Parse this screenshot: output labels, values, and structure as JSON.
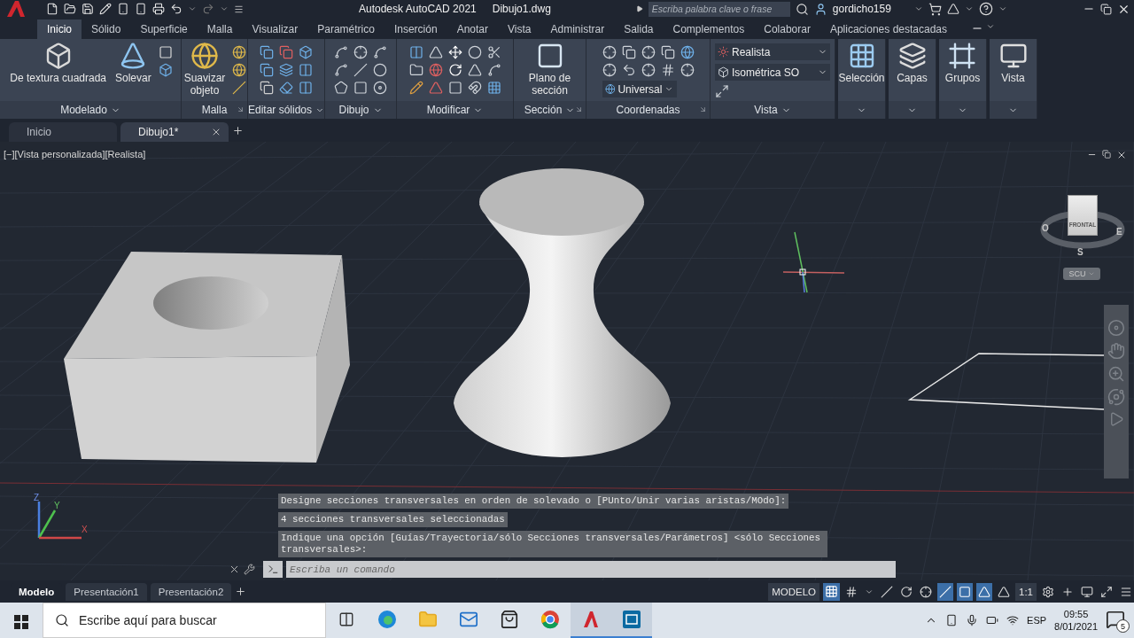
{
  "title_bar": {
    "app": "Autodesk AutoCAD 2021",
    "file": "Dibujo1.dwg",
    "search": {
      "placeholder": "Escriba palabra clave o frase"
    },
    "user": "gordicho159"
  },
  "menu_tabs": [
    {
      "label": "Inicio",
      "selected": true
    },
    {
      "label": "Sólido",
      "selected": false
    },
    {
      "label": "Superficie",
      "selected": false
    },
    {
      "label": "Malla",
      "selected": false
    },
    {
      "label": "Visualizar",
      "selected": false
    },
    {
      "label": "Paramétrico",
      "selected": false
    },
    {
      "label": "Inserción",
      "selected": false
    },
    {
      "label": "Anotar",
      "selected": false
    },
    {
      "label": "Vista",
      "selected": false
    },
    {
      "label": "Administrar",
      "selected": false
    },
    {
      "label": "Salida",
      "selected": false
    },
    {
      "label": "Complementos",
      "selected": false
    },
    {
      "label": "Colaborar",
      "selected": false
    },
    {
      "label": "Aplicaciones destacadas",
      "selected": false
    }
  ],
  "ribbon_panels": [
    {
      "title": "Modelado",
      "buttons": [
        "De textura cuadrada",
        "Solevar"
      ]
    },
    {
      "title": "Malla",
      "buttons": [
        "Suavizar objeto"
      ]
    },
    {
      "title": "Editar sólidos"
    },
    {
      "title": "Dibujo"
    },
    {
      "title": "Modificar"
    },
    {
      "title": "Sección",
      "buttons": [
        "Plano de sección"
      ]
    },
    {
      "title": "Coordenadas",
      "dropdowns": [
        "Universal"
      ]
    },
    {
      "title": "Vista",
      "dropdowns": [
        "Realista",
        "Isométrica SO"
      ]
    },
    {
      "buttons": [
        "Selección"
      ]
    },
    {
      "buttons": [
        "Capas"
      ]
    },
    {
      "buttons": [
        "Grupos"
      ]
    },
    {
      "buttons": [
        "Vista"
      ]
    }
  ],
  "file_tabs": [
    {
      "label": "Inicio",
      "selected": false
    },
    {
      "label": "Dibujo1*",
      "selected": true
    }
  ],
  "viewport": {
    "label": "[−][Vista personalizada][Realista]",
    "viewcube": {
      "face": "FRONTAL",
      "west": "O",
      "east": "E",
      "south": "S",
      "ucs": "SCU"
    },
    "ucs_icon": {
      "x": "X",
      "y": "Y",
      "z": "Z"
    }
  },
  "command_line": {
    "history": [
      "Designe secciones transversales en orden de solevado o [PUnto/Unir varias aristas/MOdo]:",
      "4 secciones transversales seleccionadas",
      "Indique una opción [Guías/Trayectoria/sólo Secciones transversales/Parámetros] <sólo Secciones transversales>:"
    ],
    "input": {
      "placeholder": "Escriba un comando"
    }
  },
  "layout_tabs": [
    {
      "label": "Modelo",
      "selected": true
    },
    {
      "label": "Presentación1",
      "selected": false
    },
    {
      "label": "Presentación2",
      "selected": false
    }
  ],
  "status_bar": {
    "space": "MODELO",
    "scale": "1:1"
  },
  "taskbar": {
    "search": {
      "placeholder": "Escribe aquí para buscar"
    },
    "language": "ESP",
    "time": "09:55",
    "date": "8/01/2021",
    "notifications": "5"
  }
}
